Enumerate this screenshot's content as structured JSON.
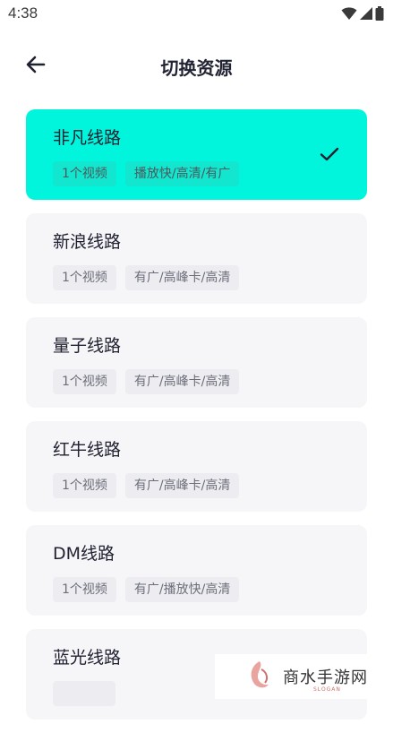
{
  "status_bar": {
    "time": "4:38"
  },
  "header": {
    "title": "切换资源"
  },
  "items": [
    {
      "name": "非凡线路",
      "count": "1个视频",
      "desc": "播放快/高清/有广",
      "selected": true
    },
    {
      "name": "新浪线路",
      "count": "1个视频",
      "desc": "有广/高峰卡/高清",
      "selected": false
    },
    {
      "name": "量子线路",
      "count": "1个视频",
      "desc": "有广/高峰卡/高清",
      "selected": false
    },
    {
      "name": "红牛线路",
      "count": "1个视频",
      "desc": "有广/高峰卡/高清",
      "selected": false
    },
    {
      "name": "DM线路",
      "count": "1个视频",
      "desc": "有广/播放快/高清",
      "selected": false
    },
    {
      "name": "蓝光线路",
      "count": "",
      "desc": "",
      "selected": false
    }
  ],
  "watermark": {
    "text": "商水手游网",
    "sub": "SLOGAN"
  },
  "colors": {
    "accent": "#00f5dc",
    "card_bg": "#f6f6f8",
    "tag_bg": "#ededf1"
  }
}
